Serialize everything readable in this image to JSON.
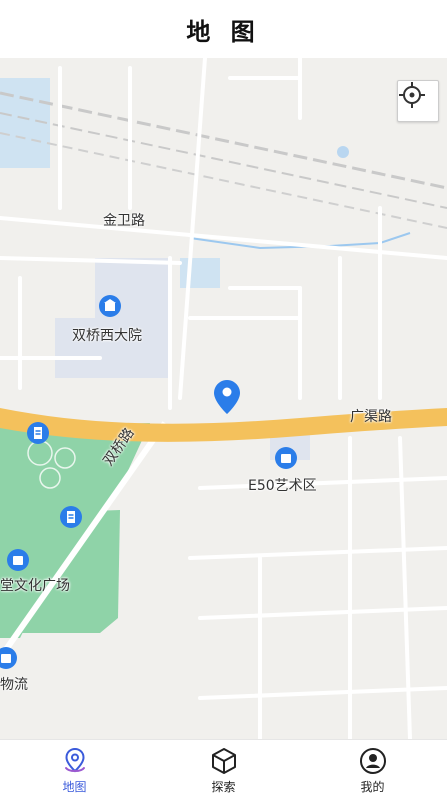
{
  "header": {
    "title": "地 图"
  },
  "map": {
    "labels": {
      "road_jinwei": "金卫路",
      "poi_shuangqiao": "双桥西大院",
      "road_guangqu": "广渠路",
      "road_shuangqiao": "双桥路",
      "poi_e50": "E50艺术区",
      "poi_culture": "堂文化广场",
      "poi_logistics": "物流"
    },
    "colors": {
      "main_road": "#f4c15c",
      "park": "#8fd3a8",
      "pin": "#2b7de9",
      "poi": "#2b7de9"
    },
    "locate_icon": "crosshair-icon"
  },
  "tabbar": {
    "items": [
      {
        "label": "地图",
        "icon": "map-pin-icon",
        "active": true
      },
      {
        "label": "探索",
        "icon": "cube-icon",
        "active": false
      },
      {
        "label": "我的",
        "icon": "user-circle-icon",
        "active": false
      }
    ],
    "active_color": "#3b5bdb"
  }
}
